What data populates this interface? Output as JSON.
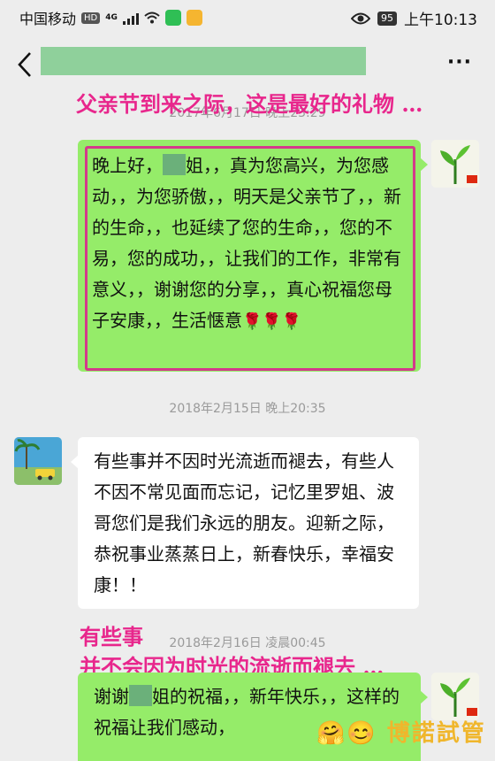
{
  "status_bar": {
    "carrier": "中国移动",
    "hd": "HD",
    "network": "4G",
    "battery": "95",
    "time": "上午10:13"
  },
  "header": {
    "more": "···"
  },
  "overlays": {
    "caption_top": "父亲节到来之际，这是最好的礼物 …",
    "caption_mid_1": "有些事",
    "caption_mid_2": "并不会因为时光的流逝而褪去 …"
  },
  "messages": [
    {
      "timestamp": "2017年6月17日 晚上23:29",
      "sender": "self",
      "text_a": "晚上好，",
      "text_b": "姐，，真为您高兴，为您感动，，为您骄傲，，明天是父亲节了，，新的生命，，也延续了您的生命，，您的不易，您的成功，，让我们的工作，非常有意义，，谢谢您的分享，，真心祝福您母子安康，，生活惬意",
      "emoji": "🌹🌹🌹"
    },
    {
      "timestamp": "2018年2月15日 晚上20:35",
      "sender": "other",
      "text": "有些事并不因时光流逝而褪去，有些人不因不常见面而忘记，记忆里罗姐、波哥您们是我们永远的朋友。迎新之际，恭祝事业蒸蒸日上，新春快乐，幸福安康！！"
    },
    {
      "timestamp": "2018年2月16日 凌晨00:45",
      "sender": "self",
      "text_a": "谢谢",
      "text_b": "姐的祝福，，新年快乐，，这样的祝福让我们感动，"
    }
  ],
  "watermark": "🤗😊 博諾試管",
  "colors": {
    "self_bubble": "#95ec69",
    "other_bubble": "#ffffff",
    "overlay_text": "#e8268c",
    "background": "#ededed"
  }
}
